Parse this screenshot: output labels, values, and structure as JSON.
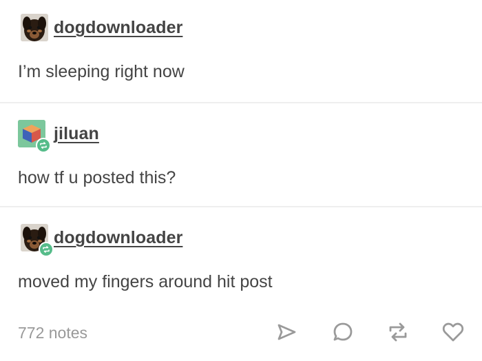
{
  "posts": [
    {
      "username": "dogdownloader",
      "text": "I’m sleeping right now",
      "avatar_icon": "dog-avatar",
      "reblogged": false
    },
    {
      "username": "jiluan",
      "text": "how tf u posted this?",
      "avatar_icon": "cube-avatar",
      "reblogged": true
    },
    {
      "username": "dogdownloader",
      "text": "moved my fingers around hit post",
      "avatar_icon": "dog-avatar",
      "reblogged": true
    }
  ],
  "footer": {
    "notes_label": "772 notes",
    "actions": [
      "share-icon",
      "reply-icon",
      "reblog-icon",
      "like-icon"
    ]
  },
  "colors": {
    "text": "#444444",
    "muted": "#999999",
    "reblog_badge": "#56bc8a",
    "divider": "#eeeeee"
  }
}
